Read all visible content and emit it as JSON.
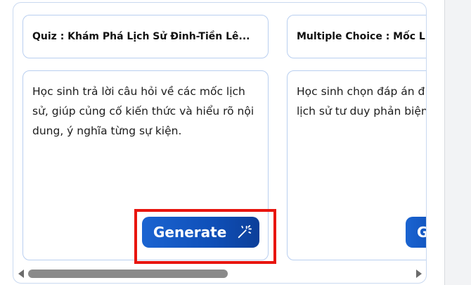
{
  "cards": [
    {
      "title": "Quiz : Khám Phá Lịch Sử Đinh-Tiền Lê...",
      "description": "Học sinh trả lời câu hỏi về các mốc lịch sử, giúp củng cố kiến thức và hiểu rõ nội dung, ý nghĩa từng sự kiện.",
      "button_label": "Generate",
      "button_icon": "magic-wand-icon"
    },
    {
      "title": "Multiple Choice : Mốc L",
      "description": "Học sinh chọn đáp án đ câu hỏi về mốc lịch sử tư duy phản biện và gh",
      "button_label": "G",
      "button_icon": "magic-wand-icon"
    }
  ],
  "highlight_color": "#e8150f",
  "accent_color": "#1b64d1"
}
